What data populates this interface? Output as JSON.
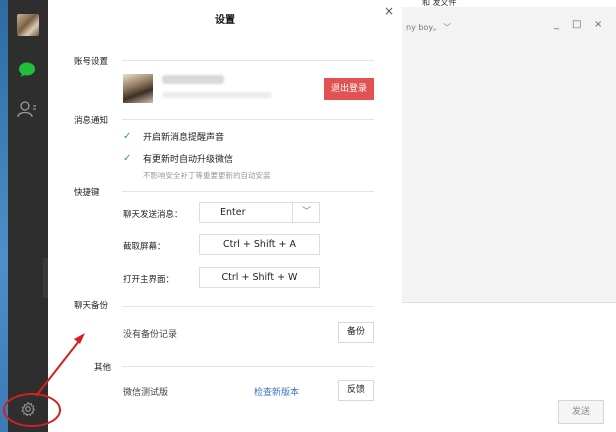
{
  "dialog": {
    "title": "设置",
    "close_glyph": "×"
  },
  "account": {
    "section_label": "账号设置",
    "logout_label": "退出登录"
  },
  "notifications": {
    "section_label": "消息通知",
    "options": [
      {
        "label": "开启新消息提醒声音",
        "checked": true
      },
      {
        "label": "有更新时自动升级微信",
        "checked": true
      }
    ],
    "hint": "不影响安全补丁等重要更新的自动安装"
  },
  "shortcuts": {
    "section_label": "快捷键",
    "items": [
      {
        "label": "聊天发送消息：",
        "value": "Enter"
      },
      {
        "label": "截取屏幕：",
        "value": "Ctrl + Shift + A"
      },
      {
        "label": "打开主界面：",
        "value": "Ctrl + Shift + W"
      }
    ]
  },
  "backup": {
    "section_label": "聊天备份",
    "status": "没有备份记录",
    "button_label": "备份"
  },
  "other": {
    "section_label": "其他",
    "version": "微信测试版",
    "check_update_label": "检查新版本",
    "feedback_label": "反馈"
  },
  "chat_window": {
    "top_text": "和  发文件",
    "contact_name": "ny boy。",
    "send_label": "发送",
    "controls": [
      "_",
      "□",
      "×"
    ]
  },
  "colors": {
    "sidebar": "#2e2e2e",
    "logout": "#e25252",
    "accent_link": "#3b74c8",
    "check": "#3ba33b",
    "annotation": "#d42020"
  }
}
